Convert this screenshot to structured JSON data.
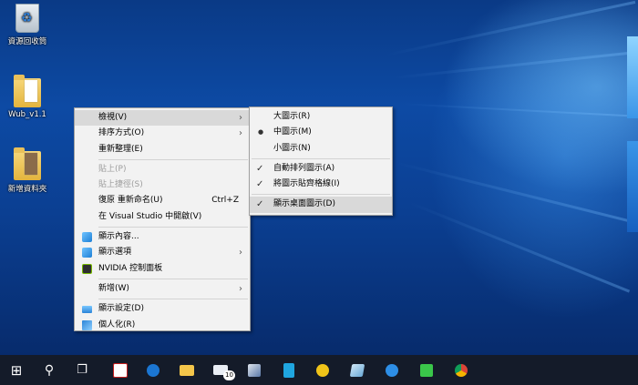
{
  "desktop_icons": [
    {
      "label": "資源回收筒",
      "icon": "recycle-bin-icon"
    },
    {
      "label": "Wub_v1.1",
      "icon": "folder-icon"
    },
    {
      "label": "新增資料夾",
      "icon": "folder-icon"
    }
  ],
  "context_menu": {
    "items": [
      {
        "label": "檢視(V)",
        "arrow": "›"
      },
      {
        "label": "排序方式(O)",
        "arrow": "›"
      },
      {
        "label": "重新整理(E)"
      },
      {
        "label": "貼上(P)"
      },
      {
        "label": "貼上捷徑(S)"
      },
      {
        "label": "復原 重新命名(U)",
        "shortcut": "Ctrl+Z"
      },
      {
        "label": "在 Visual Studio 中開啟(V)"
      },
      {
        "label": "顯示內容..."
      },
      {
        "label": "顯示選項",
        "arrow": "›"
      },
      {
        "label": "NVIDIA 控制面板"
      },
      {
        "label": "新增(W)",
        "arrow": "›"
      },
      {
        "label": "顯示設定(D)"
      },
      {
        "label": "個人化(R)"
      }
    ]
  },
  "view_submenu": {
    "items": [
      {
        "label": "大圖示(R)"
      },
      {
        "label": "中圖示(M)",
        "mark": "●"
      },
      {
        "label": "小圖示(N)"
      },
      {
        "label": "自動排列圖示(A)",
        "mark": "✓"
      },
      {
        "label": "將圖示貼齊格線(I)",
        "mark": "✓"
      },
      {
        "label": "顯示桌面圖示(D)",
        "mark": "✓"
      }
    ]
  },
  "taskbar": {
    "start": "⊞",
    "search": "⚲",
    "task_view": "❐",
    "mail_badge": "10",
    "apps": [
      "acrobat",
      "edge",
      "file-explorer",
      "mail",
      "app",
      "app",
      "app",
      "app",
      "internet-explorer",
      "line",
      "chrome"
    ]
  },
  "colors": {
    "menu_bg": "#f2f2f2",
    "menu_highlight": "#d9d9d9",
    "taskbar": "#141b29",
    "desktop": "#0d4aa4"
  }
}
